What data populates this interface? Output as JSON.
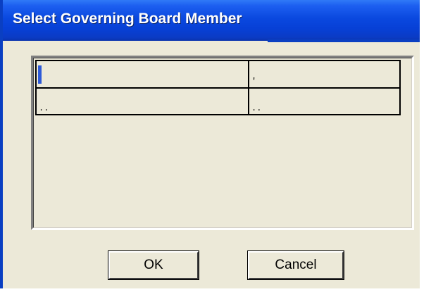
{
  "window": {
    "title": "Select Governing Board Member"
  },
  "grid": {
    "rows": [
      [
        "",
        "'"
      ],
      [
        "..",
        ".."
      ]
    ]
  },
  "buttons": {
    "ok_label": "OK",
    "cancel_label": "Cancel"
  },
  "colors": {
    "titlebar": "#0a48df",
    "dialog_bg": "#ece9d8",
    "title_text": "#ffffff"
  }
}
